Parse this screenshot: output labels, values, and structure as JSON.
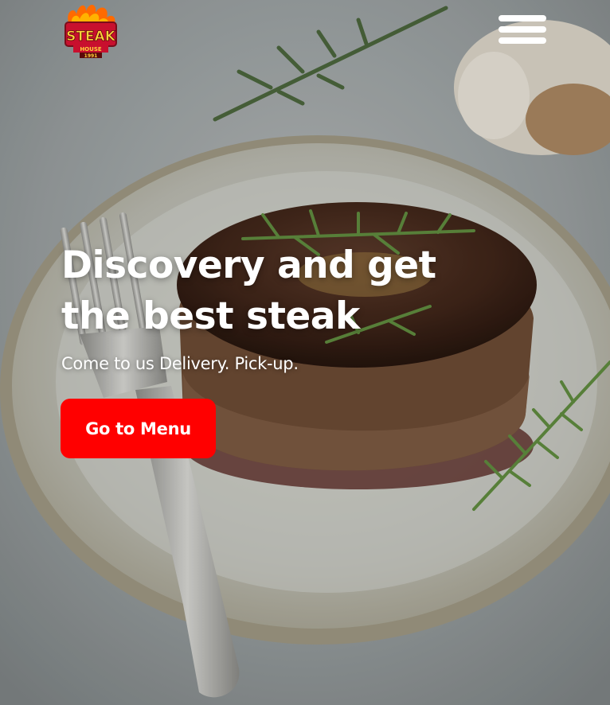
{
  "logo": {
    "line1": "STEAK",
    "line2": "HOUSE",
    "line3": "1991"
  },
  "menu": {
    "icon": "hamburger-menu-icon"
  },
  "hero": {
    "headline_line1": "Discovery and get",
    "headline_line2": "the best steak",
    "subtitle": "Come to us Delivery. Pick-up.",
    "cta_label": "Go to Menu"
  },
  "colors": {
    "accent": "#ff0000",
    "text": "#ffffff",
    "background": "#9aa0a1"
  }
}
